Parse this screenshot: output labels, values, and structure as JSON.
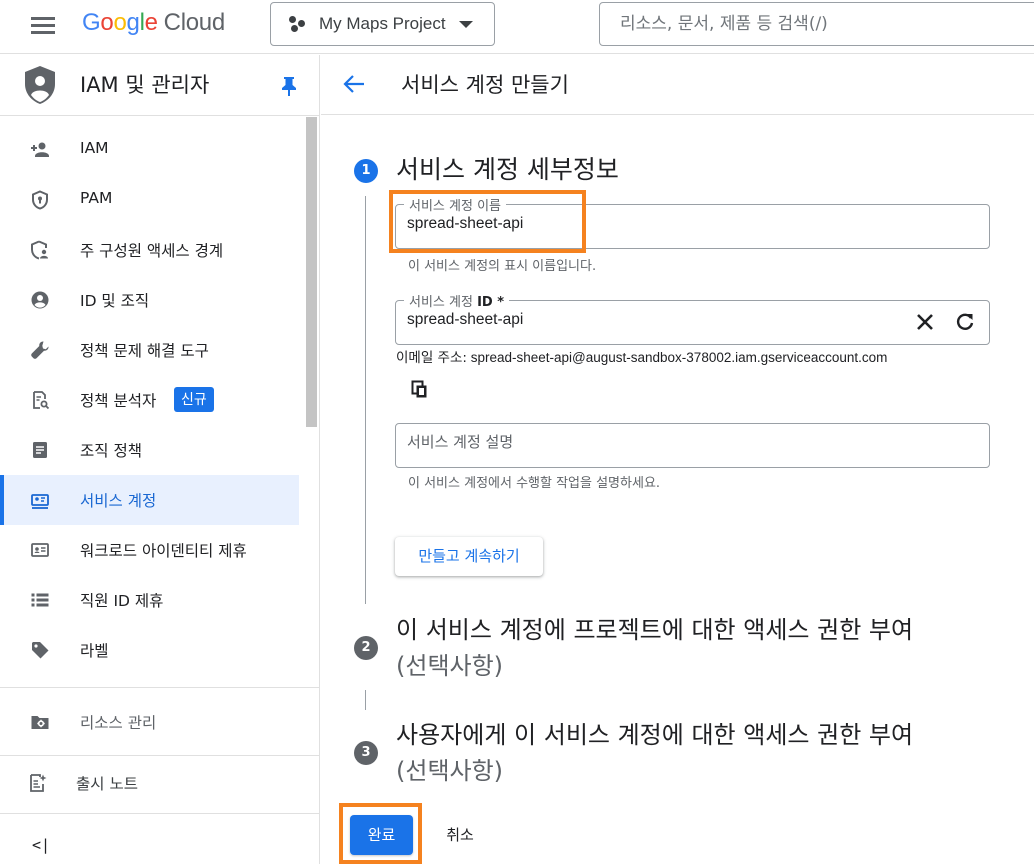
{
  "colors": {
    "accent": "#1a73e8",
    "active_bg": "#e8f0fe",
    "highlight": "#f5821f",
    "icon": "#5f6368"
  },
  "topbar": {
    "logo_letters": [
      "G",
      "o",
      "o",
      "g",
      "l",
      "e"
    ],
    "logo_product": "Cloud",
    "project_name": "My Maps Project",
    "search_placeholder": "리소스, 문서, 제품 등 검색(/)"
  },
  "sidebar": {
    "title": "IAM 및 관리자",
    "items": [
      {
        "label": "IAM",
        "icon": "person-add-icon"
      },
      {
        "label": "PAM",
        "icon": "shield-icon"
      },
      {
        "label": "주 구성원 액세스 경계",
        "icon": "shield-person-icon"
      },
      {
        "label": "ID 및 조직",
        "icon": "account-circle-icon"
      },
      {
        "label": "정책 문제 해결 도구",
        "icon": "wrench-icon"
      },
      {
        "label": "정책 분석자",
        "icon": "policy-analyzer-icon",
        "badge": "신규"
      },
      {
        "label": "조직 정책",
        "icon": "document-list-icon"
      },
      {
        "label": "서비스 계정",
        "icon": "service-account-icon",
        "active": true
      },
      {
        "label": "워크로드 아이덴티티 제휴",
        "icon": "id-card-icon"
      },
      {
        "label": "직원 ID 제휴",
        "icon": "list-icon"
      },
      {
        "label": "라벨",
        "icon": "tag-icon"
      }
    ],
    "bottom_items": [
      {
        "label": "리소스 관리",
        "icon": "folder-gear-icon"
      },
      {
        "label": "출시 노트",
        "icon": "release-notes-icon"
      }
    ],
    "collapse_label": "<|"
  },
  "main": {
    "page_title": "서비스 계정 만들기",
    "steps": [
      {
        "number": "1",
        "title": "서비스 계정 세부정보"
      },
      {
        "number": "2",
        "title": "이 서비스 계정에 프로젝트에 대한 액세스 권한 부여",
        "optional": "(선택사항)"
      },
      {
        "number": "3",
        "title": "사용자에게 이 서비스 계정에 대한 액세스 권한 부여",
        "optional": "(선택사항)"
      }
    ],
    "name_field": {
      "label": "서비스 계정 이름",
      "value": "spread-sheet-api",
      "helper": "이 서비스 계정의 표시 이름입니다."
    },
    "id_field": {
      "label": "서비스 계정",
      "label_bold": "ID *",
      "value": "spread-sheet-api"
    },
    "email_label": "이메일 주소:",
    "email_value": "spread-sheet-api@august-sandbox-378002.iam.gserviceaccount.com",
    "description_field": {
      "placeholder": "서비스 계정 설명",
      "helper": "이 서비스 계정에서 수행할 작업을 설명하세요."
    },
    "continue_button": "만들고 계속하기",
    "done_button": "완료",
    "cancel_button": "취소"
  }
}
